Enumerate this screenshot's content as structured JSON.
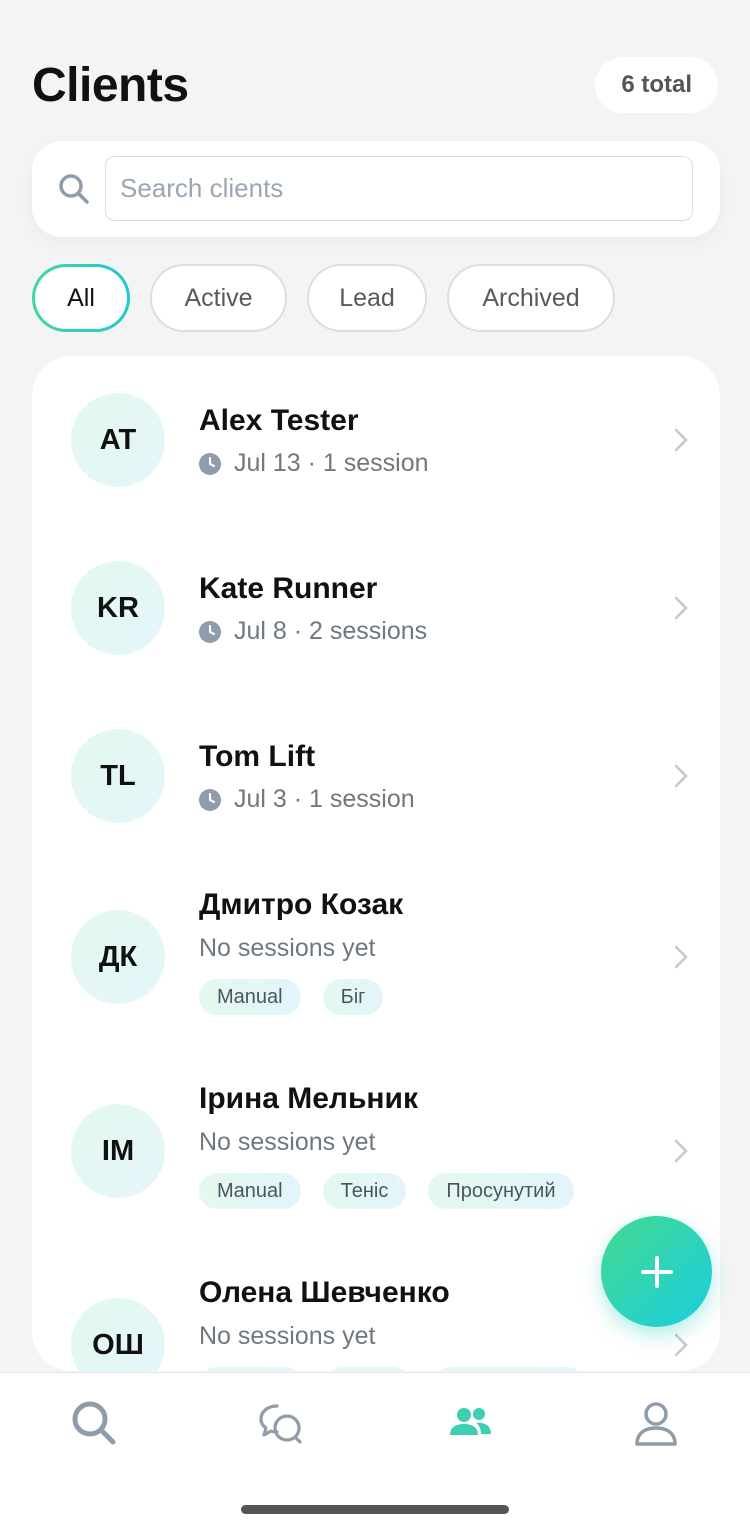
{
  "header": {
    "title": "Clients",
    "total_badge": "6 total"
  },
  "search": {
    "placeholder": "Search clients",
    "value": ""
  },
  "filters": [
    {
      "label": "All",
      "selected": true
    },
    {
      "label": "Active",
      "selected": false
    },
    {
      "label": "Lead",
      "selected": false
    },
    {
      "label": "Archived",
      "selected": false
    }
  ],
  "clients": [
    {
      "initials": "AT",
      "name": "Alex Tester",
      "meta": "Jul 13 · 1 session",
      "tags": []
    },
    {
      "initials": "KR",
      "name": "Kate Runner",
      "meta": "Jul 8 · 2 sessions",
      "tags": []
    },
    {
      "initials": "TL",
      "name": "Tom Lift",
      "meta": "Jul 3 · 1 session",
      "tags": []
    },
    {
      "initials": "ДК",
      "name": "Дмитро Козак",
      "meta": "No sessions yet",
      "tags": [
        "Manual",
        "Біг"
      ]
    },
    {
      "initials": "ІМ",
      "name": "Ірина Мельник",
      "meta": "No sessions yet",
      "tags": [
        "Manual",
        "Теніс",
        "Просунутий"
      ]
    },
    {
      "initials": "ОШ",
      "name": "Олена Шевченко",
      "meta": "No sessions yet",
      "tags": []
    }
  ],
  "fab": {
    "icon": "plus-icon"
  },
  "tabbar": [
    {
      "icon": "search-icon",
      "active": false
    },
    {
      "icon": "chat-icon",
      "active": false
    },
    {
      "icon": "users-icon",
      "active": true
    },
    {
      "icon": "profile-icon",
      "active": false
    }
  ],
  "colors": {
    "accent_start": "#43d7a0",
    "accent_end": "#22c7d4",
    "muted": "#6f7780",
    "icon_gray": "#8f9cab"
  }
}
